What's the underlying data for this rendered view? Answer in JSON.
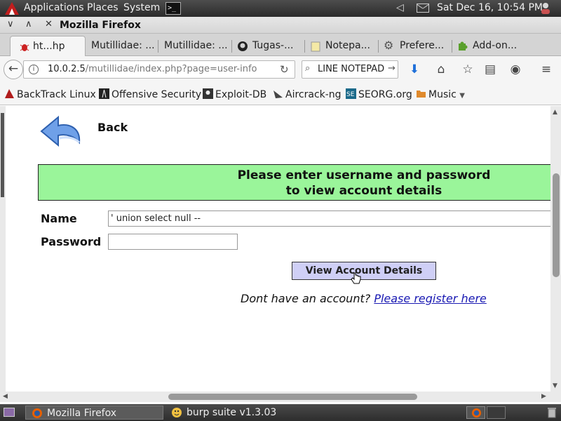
{
  "panel": {
    "menus": [
      "Applications",
      "Places",
      "System"
    ],
    "terminal_glyph": ">_",
    "clock": "Sat Dec 16, 10:54 PM"
  },
  "window": {
    "title": "Mozilla Firefox"
  },
  "tabs": [
    {
      "label": "ht...hp",
      "active": true
    },
    {
      "label": "Mutillidae: ...",
      "active": false
    },
    {
      "label": "Mutillidae: ...",
      "active": false
    },
    {
      "label": "Tugas-...",
      "active": false
    },
    {
      "label": "Notepa...",
      "active": false
    },
    {
      "label": "Prefere...",
      "active": false
    },
    {
      "label": "Add-on...",
      "active": false
    }
  ],
  "navbar": {
    "url_host": "10.0.2.5",
    "url_path": "/mutillidae/index.php?page=user-info",
    "search_text": "LINE NOTEPAD"
  },
  "bookmarks": [
    "BackTrack Linux",
    "Offensive Security",
    "Exploit-DB",
    "Aircrack-ng",
    "SEORG.org",
    "Music"
  ],
  "page": {
    "back_label": "Back",
    "banner_line1": "Please enter username and password",
    "banner_line2": "to view account details",
    "name_label": "Name",
    "name_value": "' union select null --",
    "password_label": "Password",
    "password_value": "",
    "submit_label": "View Account Details",
    "register_prompt": "Dont have an account?",
    "register_link": "Please register here"
  },
  "taskbar": {
    "tasks": [
      {
        "label": "Mozilla Firefox",
        "active": true
      },
      {
        "label": "burp suite v1.3.03",
        "active": false
      }
    ]
  },
  "colors": {
    "banner_bg": "#9af59a",
    "button_bg": "#cfcff6",
    "link": "#1a1ab3"
  }
}
